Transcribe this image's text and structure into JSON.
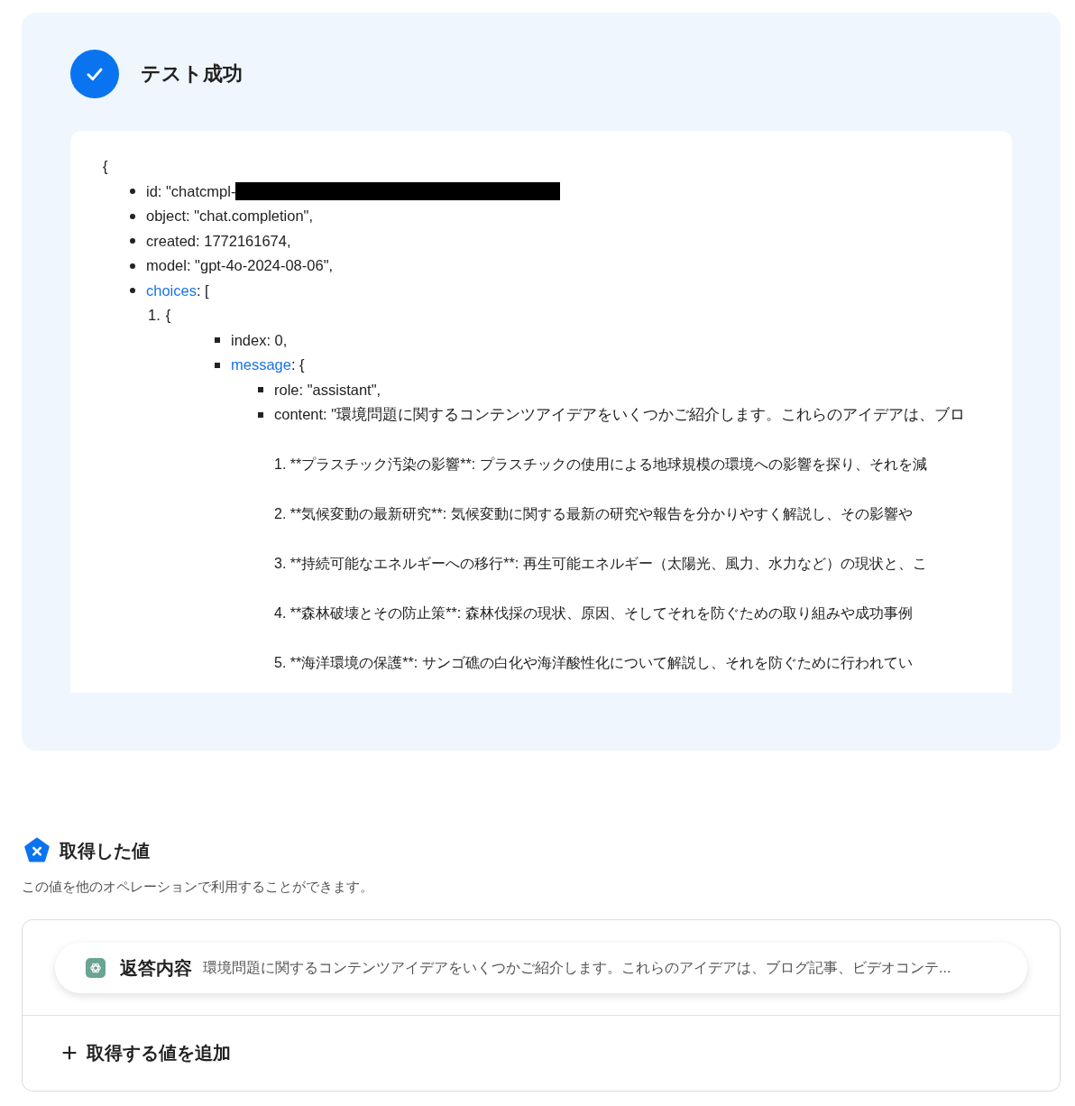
{
  "result": {
    "success": true,
    "title": "テスト成功"
  },
  "json_view": {
    "open": "{",
    "items": [
      {
        "text": "id: \"chatcmpl-",
        "redacted": true
      },
      {
        "text": "object: \"chat.completion\","
      },
      {
        "text": "created: 1772161674,"
      },
      {
        "text": "model: \"gpt-4o-2024-08-06\","
      },
      {
        "link": "choices",
        "text": ": [",
        "children": [
          {
            "marker": "1.",
            "text": "{",
            "children": [
              {
                "text": "index: 0,"
              },
              {
                "link": "message",
                "text": ": {",
                "children": [
                  {
                    "text": "role: \"assistant\","
                  },
                  {
                    "text": "content: \"環境問題に関するコンテンツアイデアをいくつかご紹介します。これらのアイデアは、ブロ",
                    "paragraphs": [
                      "1. **プラスチック汚染の影響**: プラスチックの使用による地球規模の環境への影響を探り、それを減",
                      "2. **気候変動の最新研究**: 気候変動に関する最新の研究や報告を分かりやすく解説し、その影響や",
                      "3. **持続可能なエネルギーへの移行**: 再生可能エネルギー（太陽光、風力、水力など）の現状と、こ",
                      "4. **森林破壊とその防止策**: 森林伐採の現状、原因、そしてそれを防ぐための取り組みや成功事例",
                      "5. **海洋環境の保護**: サンゴ礁の白化や海洋酸性化について解説し、それを防ぐために行われてい"
                    ]
                  }
                ]
              }
            ]
          }
        ]
      }
    ]
  },
  "values_section": {
    "title": "取得した値",
    "description": "この値を他のオペレーションで利用することができます。",
    "values": [
      {
        "label": "返答内容",
        "value": "環境問題に関するコンテンツアイデアをいくつかご紹介します。これらのアイデアは、ブログ記事、ビデオコンテ..."
      }
    ],
    "add_button": "取得する値を追加"
  }
}
